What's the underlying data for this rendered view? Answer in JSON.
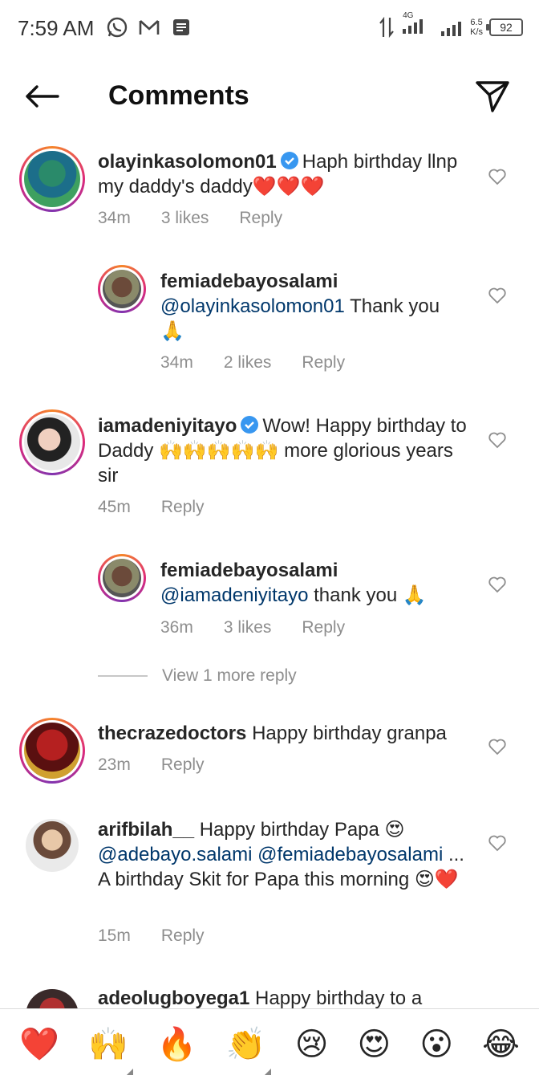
{
  "status_bar": {
    "time": "7:59 AM",
    "network": "4G",
    "speed_value": "6.5",
    "speed_unit": "K/s",
    "battery": "92"
  },
  "header": {
    "title": "Comments"
  },
  "comments": [
    {
      "username": "olayinkasolomon01",
      "text": "Haph birthday llnp my daddy's daddy",
      "emoji": "❤️❤️❤️",
      "time": "34m",
      "likes": "3 likes",
      "reply": "Reply"
    },
    {
      "username": "femiadebayosalami",
      "mention": "@olayinkasolomon01",
      "text": " Thank you",
      "emoji": "🙏",
      "time": "34m",
      "likes": "2 likes",
      "reply": "Reply"
    },
    {
      "username": "iamadeniyitayo",
      "text": "Wow! Happy birthday to Daddy",
      "emoji": "🙌🙌🙌🙌🙌",
      "text2": "more glorious years sir",
      "time": "45m",
      "reply": "Reply"
    },
    {
      "username": "femiadebayosalami",
      "mention": "@iamadeniyitayo",
      "text": " thank you",
      "emoji": "🙏",
      "time": "36m",
      "likes": "3 likes",
      "reply": "Reply"
    },
    {
      "username": "thecrazedoctors",
      "text": "Happy birthday granpa",
      "time": "23m",
      "reply": "Reply"
    },
    {
      "username": "arifbilah__",
      "text": "Happy birthday Papa",
      "emoji": "😍",
      "mention1": "@adebayo.salami",
      "mention2": "@femiadebayosalami",
      "text2": "... A birthday Skit for Papa this morning",
      "emoji2": "😍❤️",
      "time": "15m",
      "reply": "Reply"
    },
    {
      "username": "adeolugboyega1",
      "text": "Happy birthday to a"
    }
  ],
  "view_more": "View 1 more reply",
  "emoji_bar": [
    "❤️",
    "🙌",
    "🔥",
    "👏",
    "😢",
    "😍",
    "😮",
    "😂"
  ],
  "colors": {
    "mention": "#00376b",
    "meta_gray": "#8e8e8e",
    "verified_blue": "#3897f0"
  }
}
